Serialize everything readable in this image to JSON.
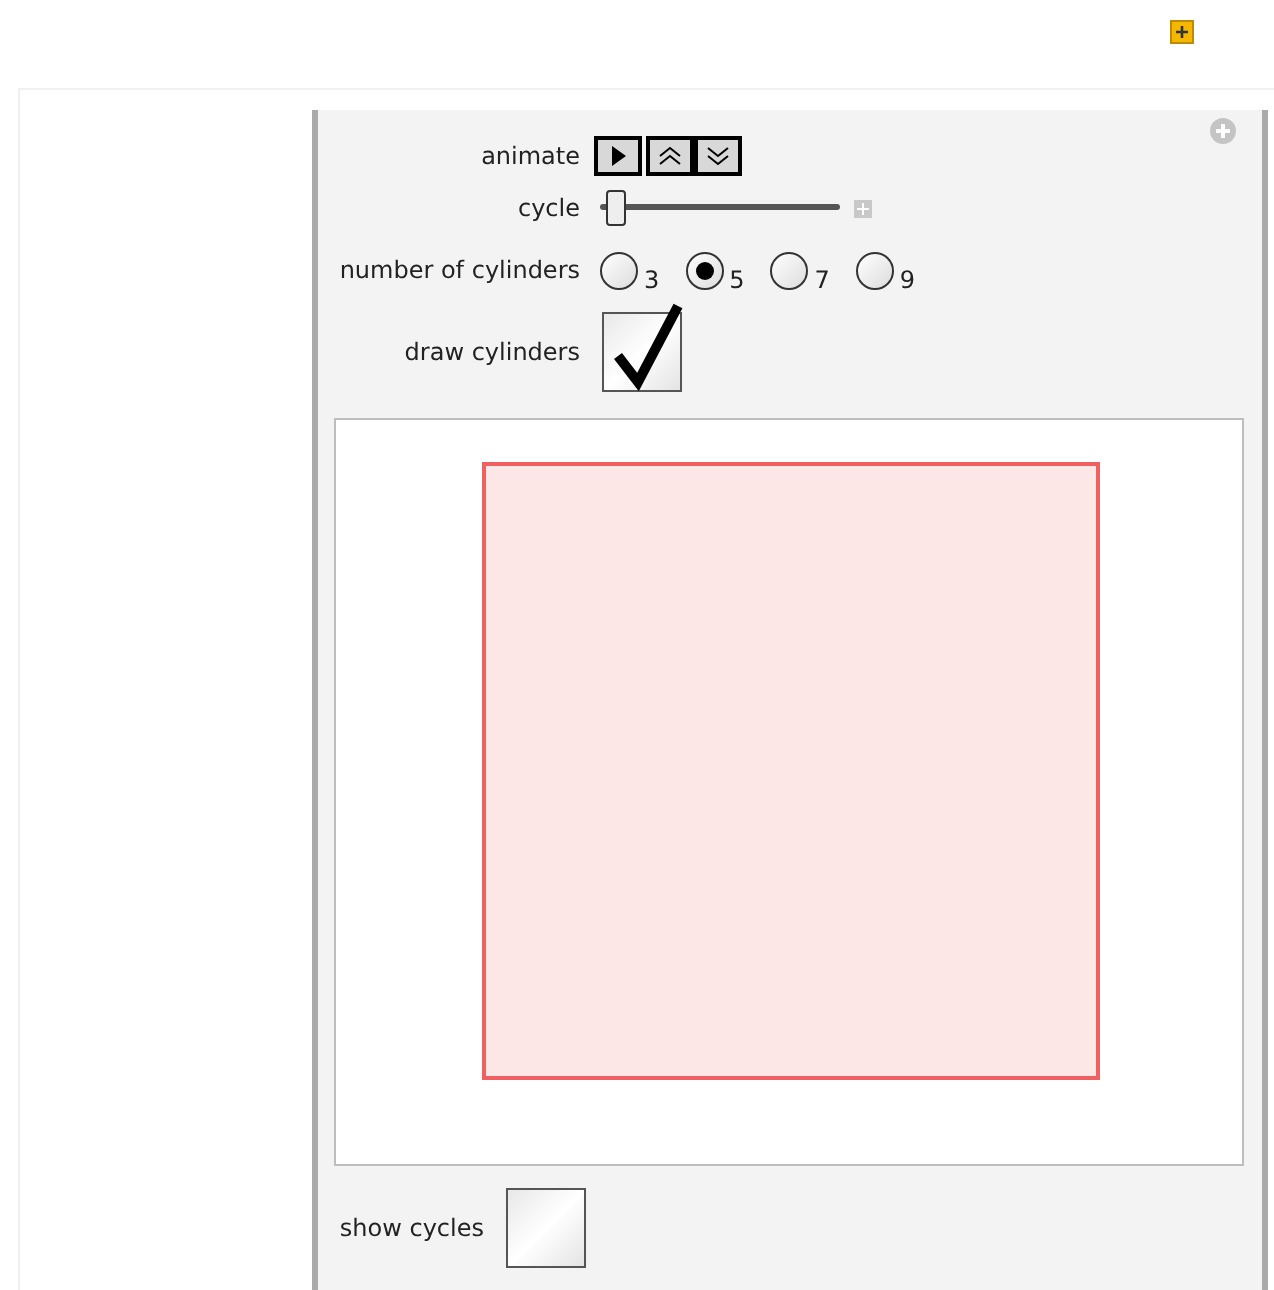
{
  "controls": [
    {
      "kind": "buttons",
      "label": "animate"
    },
    {
      "kind": "slider",
      "label": "cycle",
      "level": 0.07
    },
    {
      "kind": "radio",
      "label": "number of cylinders",
      "options": [
        {
          "label": "3",
          "selected": false
        },
        {
          "label": "5",
          "selected": true
        },
        {
          "label": "7",
          "selected": false
        },
        {
          "label": "9",
          "selected": false
        }
      ]
    },
    {
      "kind": "checkbox",
      "label": "draw cylinders",
      "checked": true
    }
  ],
  "bottom_controls": [
    {
      "kind": "checkbox",
      "label": "show cycles",
      "checked": false
    }
  ]
}
